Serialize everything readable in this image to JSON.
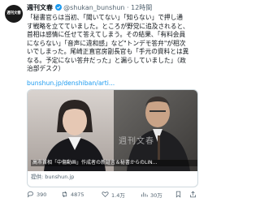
{
  "tweet": {
    "avatar_text": "週刊文春",
    "display_name": "週刊文春",
    "handle": "@shukan_bunshun",
    "separator": "·",
    "time": "12時間",
    "body_lines": [
      "「秘書官らは当初、「聞いてない」「知らない」で押し通",
      "す戦略を立てていました。ところが野党に追及されると、",
      "首相は感情に任せて答えてしまう。その結果、「有料会員",
      "にならない」「音声に違和感」など\"トンデモ答弁\"が相次",
      "いでしまった。尾崎正直官房副長官も「手元の資料とは異",
      "なる。予定にない答弁だった」と漏らしていました」（政",
      "治部デスク）"
    ],
    "link": "bunshun.jp/denshiban/arti...",
    "card": {
      "caption": "高市首相「中傷動画」作成者の新証言＆秘書からのLIN...",
      "watermark": "週刊文春",
      "source": "提供: bunshun.jp"
    },
    "actions": {
      "reply_count": "390",
      "retweet_count": "4875",
      "like_count": "1.4万",
      "view_count": "30万"
    }
  }
}
